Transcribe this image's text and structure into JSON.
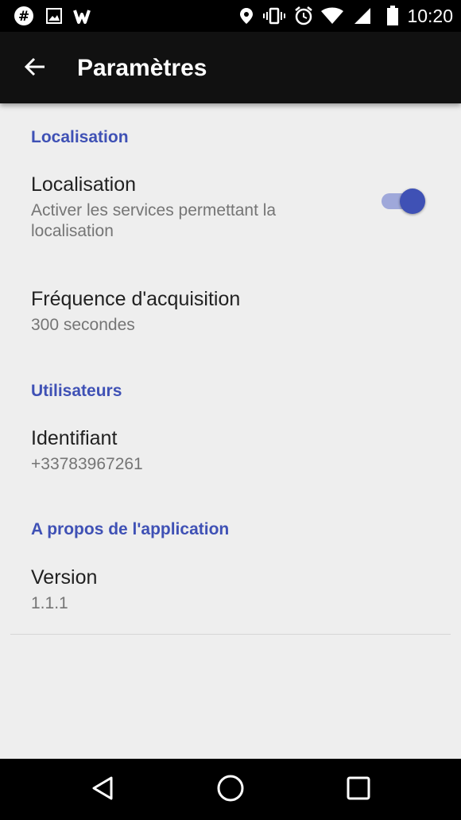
{
  "status_bar": {
    "time": "10:20",
    "left_icons": [
      "slack-icon",
      "image-icon",
      "wattpad-icon"
    ],
    "right_icons": [
      "location-icon",
      "vibrate-icon",
      "alarm-icon",
      "wifi-icon",
      "signal-icon",
      "battery-icon"
    ]
  },
  "app_bar": {
    "title": "Paramètres",
    "back_icon": "arrow-back-icon"
  },
  "sections": {
    "location": {
      "header": "Localisation",
      "location_pref": {
        "title": "Localisation",
        "summary": "Activer les services permettant la localisation",
        "enabled": true
      },
      "frequency_pref": {
        "title": "Fréquence d'acquisition",
        "summary": "300 secondes"
      }
    },
    "users": {
      "header": "Utilisateurs",
      "identifier_pref": {
        "title": "Identifiant",
        "summary": "+33783967261"
      }
    },
    "about": {
      "header": "A propos de l'application",
      "version_pref": {
        "title": "Version",
        "summary": "1.1.1"
      }
    }
  },
  "nav_bar": {
    "buttons": [
      "back-triangle-icon",
      "home-circle-icon",
      "recents-square-icon"
    ]
  },
  "colors": {
    "accent": "#3f51b5",
    "accent_light": "#9fa8da",
    "background": "#eeeeee",
    "app_bar": "#111111"
  }
}
